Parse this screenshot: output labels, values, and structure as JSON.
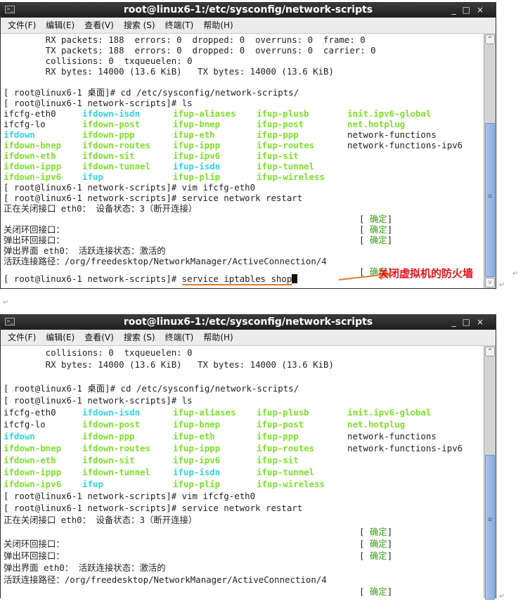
{
  "window_title": "root@linux6-1:/etc/sysconfig/network-scripts",
  "window_controls": {
    "minimize": "_",
    "maximize": "□",
    "close": "×"
  },
  "menu": [
    "文件(F)",
    "编辑(E)",
    "查看(V)",
    "搜索 (S)",
    "终端(T)",
    "帮助(H)"
  ],
  "colors": {
    "dir_cyan": "#2fd5e3",
    "exec_green": "#7ee02c",
    "ok_green": "#3a9d17",
    "annotation_red": "#e8121a",
    "arrow_orange": "#e07a2d"
  },
  "top_terminal": {
    "stats": [
      "        RX packets: 188  errors: 0  dropped: 0  overruns: 0  frame: 0",
      "        TX packets: 188  errors: 0  dropped: 0  overruns: 0  carrier: 0",
      "        collisions: 0  txqueuelen: 0",
      "        RX bytes: 14000 (13.6 KiB)   TX bytes: 14000 (13.6 KiB)"
    ],
    "last_prompt": "[ root@linux6-1 network-scripts]# ",
    "last_command": "service iptables shop",
    "annotation": "关闭虚拟机的防火墙"
  },
  "bottom_terminal": {
    "stats": [
      "        collisions: 0  txqueuelen: 0",
      "        RX bytes: 14000 (13.6 KiB)   TX bytes: 14000 (13.6 KiB)"
    ]
  },
  "session": {
    "cmd_cd": "[ root@linux6-1 桌面]# cd /etc/sysconfig/network-scripts/",
    "cmd_ls": "[ root@linux6-1 network-scripts]# ls",
    "ls_rows": [
      [
        {
          "t": "ifcfg-eth0",
          "c": ""
        },
        {
          "t": "ifdown-isdn",
          "c": "cyan"
        },
        {
          "t": "ifup-aliases",
          "c": "green"
        },
        {
          "t": "ifup-plusb",
          "c": "green"
        },
        {
          "t": "init.ipv6-global",
          "c": "green"
        }
      ],
      [
        {
          "t": "ifcfg-lo",
          "c": ""
        },
        {
          "t": "ifdown-post",
          "c": "green"
        },
        {
          "t": "ifup-bnep",
          "c": "green"
        },
        {
          "t": "ifup-post",
          "c": "green"
        },
        {
          "t": "net.hotplug",
          "c": "green"
        }
      ],
      [
        {
          "t": "ifdown",
          "c": "cyan"
        },
        {
          "t": "ifdown-ppp",
          "c": "green"
        },
        {
          "t": "ifup-eth",
          "c": "green"
        },
        {
          "t": "ifup-ppp",
          "c": "green"
        },
        {
          "t": "network-functions",
          "c": ""
        }
      ],
      [
        {
          "t": "ifdown-bnep",
          "c": "green"
        },
        {
          "t": "ifdown-routes",
          "c": "green"
        },
        {
          "t": "ifup-ippp",
          "c": "green"
        },
        {
          "t": "ifup-routes",
          "c": "green"
        },
        {
          "t": "network-functions-ipv6",
          "c": ""
        }
      ],
      [
        {
          "t": "ifdown-eth",
          "c": "green"
        },
        {
          "t": "ifdown-sit",
          "c": "green"
        },
        {
          "t": "ifup-ipv6",
          "c": "green"
        },
        {
          "t": "ifup-sit",
          "c": "green"
        },
        {
          "t": "",
          "c": ""
        }
      ],
      [
        {
          "t": "ifdown-ippp",
          "c": "green"
        },
        {
          "t": "ifdown-tunnel",
          "c": "green"
        },
        {
          "t": "ifup-isdn",
          "c": "cyan"
        },
        {
          "t": "ifup-tunnel",
          "c": "green"
        },
        {
          "t": "",
          "c": ""
        }
      ],
      [
        {
          "t": "ifdown-ipv6",
          "c": "green"
        },
        {
          "t": "ifup",
          "c": "cyan"
        },
        {
          "t": "ifup-plip",
          "c": "green"
        },
        {
          "t": "ifup-wireless",
          "c": "green"
        },
        {
          "t": "",
          "c": ""
        }
      ]
    ],
    "cmd_vim": "[ root@linux6-1 network-scripts]# vim ifcfg-eth0",
    "cmd_restart": "[ root@linux6-1 network-scripts]# service network restart",
    "msg_closing": "正在关闭接口 eth0： 设备状态：3（断开连接）",
    "msg_close_lo": "关闭环回接口：",
    "msg_up_lo": "弹出环回接口：",
    "msg_up_eth": "弹出界面 eth0： 活跃连接状态：激活的",
    "msg_path": "活跃连接路径：/org/freedesktop/NetworkManager/ActiveConnection/4",
    "ok_label": "确定"
  }
}
